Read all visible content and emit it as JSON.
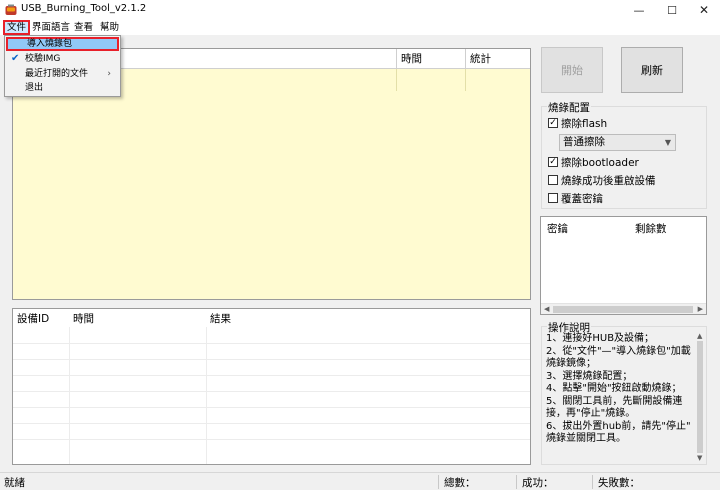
{
  "window": {
    "title": "USB_Burning_Tool_v2.1.2",
    "controls": {
      "minimize": "—",
      "maximize": "☐",
      "close": "✕"
    }
  },
  "menubar": {
    "items": [
      "文件",
      "界面語言",
      "查看",
      "幫助"
    ]
  },
  "file_menu": {
    "items": [
      {
        "label": "導入燒錄包",
        "highlighted": true
      },
      {
        "label": "校驗IMG",
        "checked": true
      },
      {
        "label": "最近打開的文件",
        "has_submenu": true
      },
      {
        "label": "退出"
      }
    ]
  },
  "device_table": {
    "columns": [
      "",
      "時間",
      "統計"
    ]
  },
  "log_table": {
    "columns": [
      "設備ID",
      "時間",
      "結果"
    ]
  },
  "buttons": {
    "start": "開始",
    "refresh": "刷新"
  },
  "config": {
    "title": "燒錄配置",
    "erase_flash": {
      "label": "擦除flash",
      "checked": true
    },
    "erase_mode": {
      "selected": "普通擦除"
    },
    "erase_bootloader": {
      "label": "擦除bootloader",
      "checked": true
    },
    "reboot_after_success": {
      "label": "燒錄成功後重啟設備",
      "checked": false
    },
    "overwrite_key": {
      "label": "覆蓋密鑰",
      "checked": false
    }
  },
  "key_table": {
    "columns": [
      "密鑰",
      "剩餘數"
    ]
  },
  "instructions": {
    "title": "操作說明",
    "lines": [
      "1、連接好HUB及設備；",
      "2、從\"文件\"—\"導入燒錄包\"加載",
      "燒錄鏡像；",
      "3、選擇燒錄配置；",
      "4、點擊\"開始\"按鈕啟動燒錄；",
      "5、關閉工具前，先斷開設備連",
      "接，再\"停止\"燒錄。",
      "6、拔出外置hub前，請先\"停止\"",
      "燒錄並關閉工具。"
    ]
  },
  "statusbar": {
    "status": "就緒",
    "total_label": "總數：",
    "success_label": "成功：",
    "fail_label": "失敗數："
  },
  "colors": {
    "device_panel_bg": "#fffbd1",
    "highlight_border": "#e8202a",
    "menu_highlight": "#91c9f7"
  }
}
